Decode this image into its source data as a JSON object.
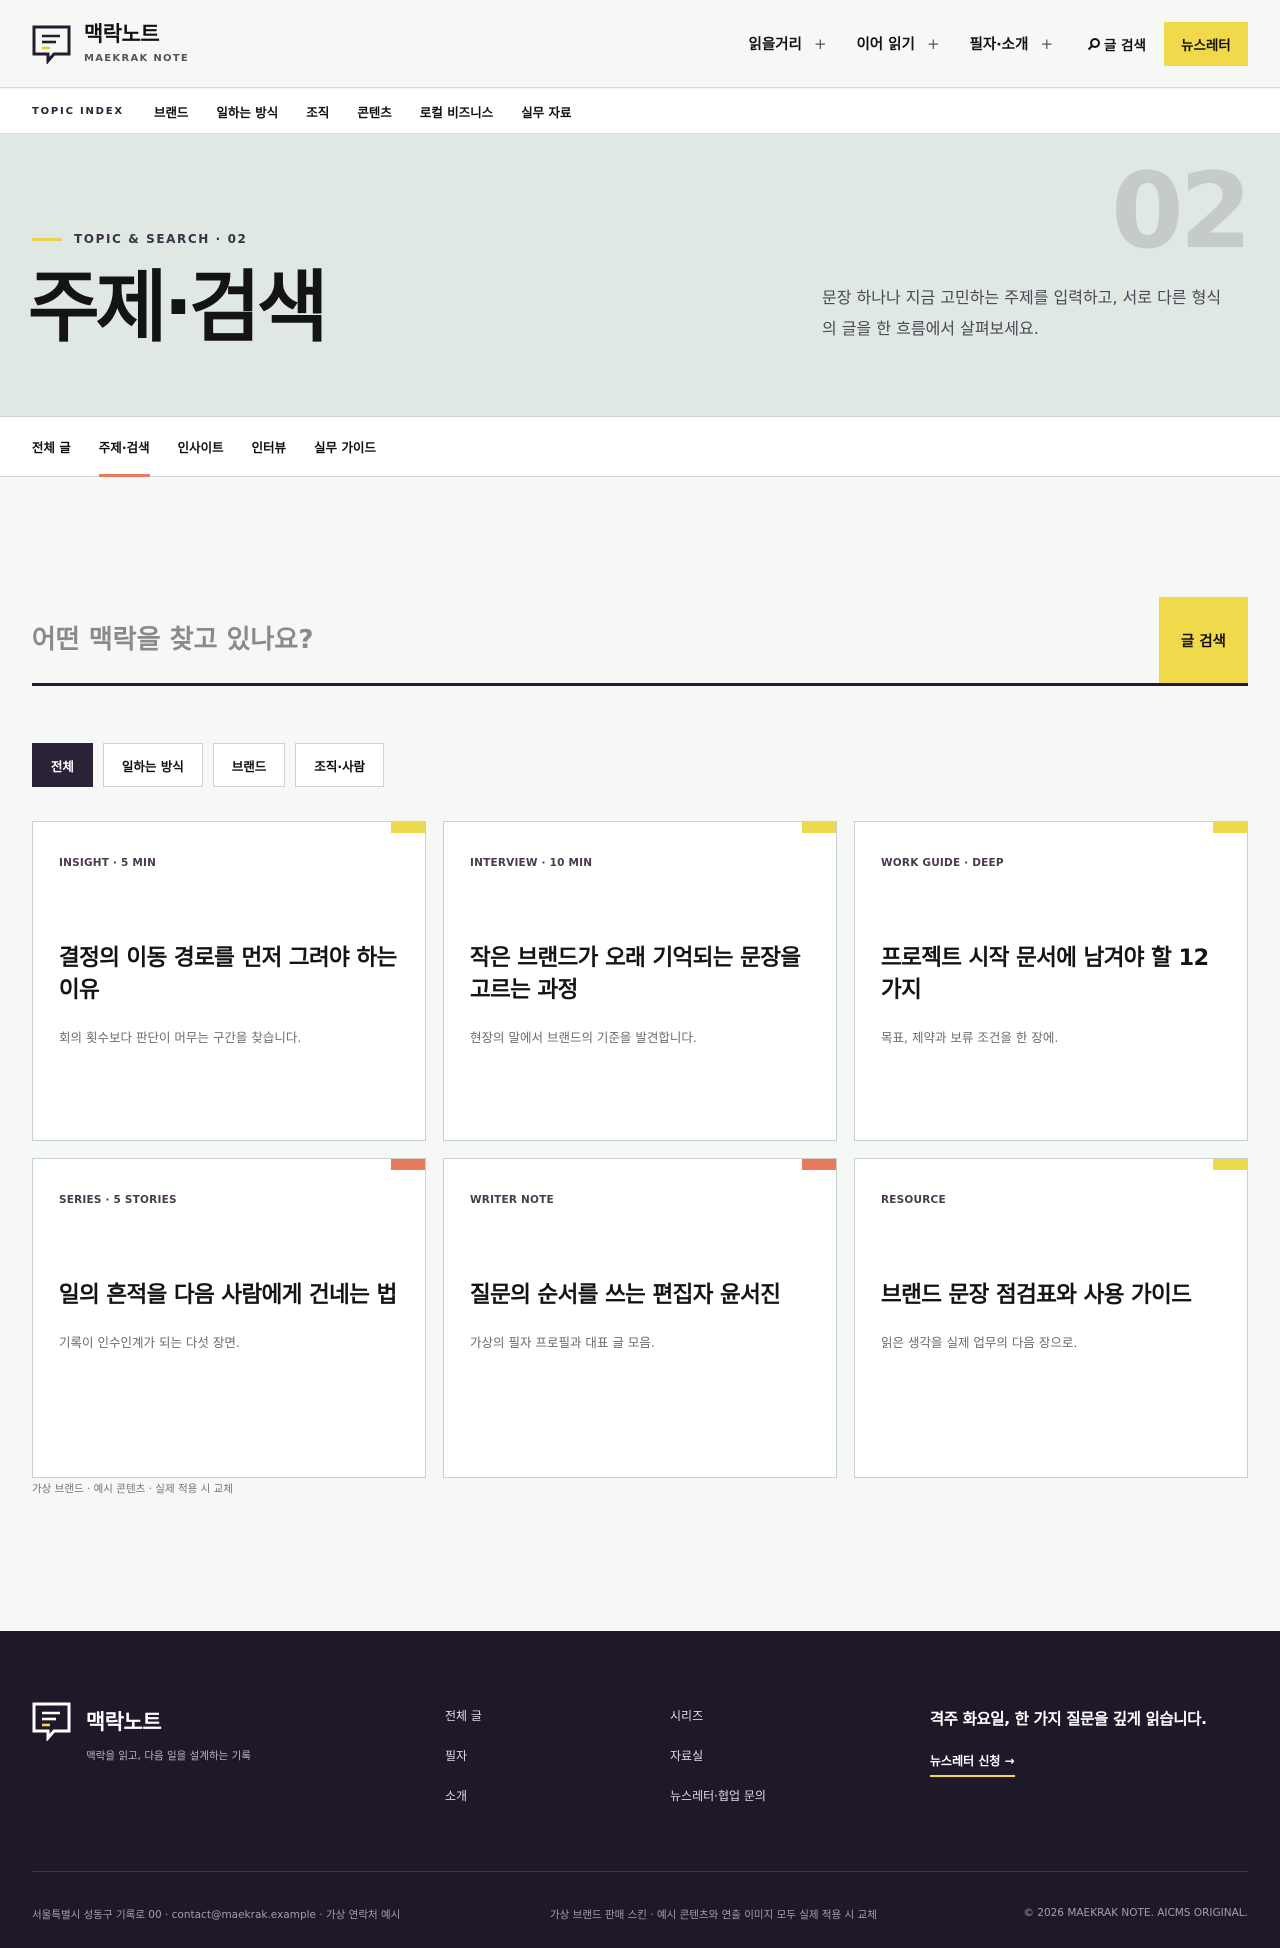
{
  "header": {
    "brand_name": "맥락노트",
    "brand_sub": "MAEKRAK NOTE",
    "nav": [
      {
        "label": "읽을거리",
        "suffix": "+"
      },
      {
        "label": "이어 읽기",
        "suffix": "+"
      },
      {
        "label": "필자·소개",
        "suffix": "+"
      }
    ],
    "search_label": "글 검색",
    "newsletter_label": "뉴스레터"
  },
  "topic_index": {
    "label": "TOPIC INDEX",
    "links": [
      "브랜드",
      "일하는 방식",
      "조직",
      "콘텐츠",
      "로컬 비즈니스",
      "실무 자료"
    ]
  },
  "hero": {
    "eyebrow": "TOPIC & SEARCH · 02",
    "title": "주제·검색",
    "number": "02",
    "description": "문장 하나나 지금 고민하는 주제를 입력하고, 서로 다른 형식의 글을 한 흐름에서 살펴보세요."
  },
  "tabs": [
    "전체 글",
    "주제·검색",
    "인사이트",
    "인터뷰",
    "실무 가이드"
  ],
  "active_tab": "주제·검색",
  "search": {
    "placeholder": "어떤 맥락을 찾고 있나요?",
    "value": "",
    "button_label": "글 검색"
  },
  "filters": [
    "전체",
    "일하는 방식",
    "브랜드",
    "조직·사람"
  ],
  "active_filter": "전체",
  "cards": [
    {
      "meta": "INSIGHT · 5 MIN",
      "title": "결정의 이동 경로를 먼저 그려야 하는 이유",
      "summary": "회의 횟수보다 판단이 머무는 구간을 찾습니다.",
      "accent": "#ecd94c"
    },
    {
      "meta": "INTERVIEW · 10 MIN",
      "title": "작은 브랜드가 오래 기억되는 문장을 고르는 과정",
      "summary": "현장의 말에서 브랜드의 기준을 발견합니다.",
      "accent": "#ecd94c"
    },
    {
      "meta": "WORK GUIDE · DEEP",
      "title": "프로젝트 시작 문서에 남겨야 할 12가지",
      "summary": "목표, 제약과 보류 조건을 한 장에.",
      "accent": "#ecd94c"
    },
    {
      "meta": "SERIES · 5 STORIES",
      "title": "일의 흔적을 다음 사람에게 건네는 법",
      "summary": "기록이 인수인계가 되는 다섯 장면.",
      "accent": "#e87a5e"
    },
    {
      "meta": "WRITER NOTE",
      "title": "질문의 순서를 쓰는 편집자 윤서진",
      "summary": "가상의 필자 프로필과 대표 글 모음.",
      "accent": "#e87a5e"
    },
    {
      "meta": "RESOURCE",
      "title": "브랜드 문장 점검표와 사용 가이드",
      "summary": "읽은 생각을 실제 업무의 다음 장으로.",
      "accent": "#ecd94c"
    }
  ],
  "caption": "가상 브랜드 · 예시 콘텐츠 · 실제 적용 시 교체",
  "footer": {
    "brand_name": "맥락노트",
    "tagline": "맥락을 읽고, 다음 일을 설계하는 기록",
    "col1": [
      "전체 글",
      "필자",
      "소개"
    ],
    "col2": [
      "시리즈",
      "자료실",
      "뉴스레터·협업 문의"
    ],
    "cta_title": "격주 화요일, 한 가지 질문을 깊게 읽습니다.",
    "cta_link": "뉴스레터 신청",
    "address": "서울특별시 성동구 기록로 00 · contact@maekrak.example · 가상 연락처 예시",
    "notice": "가상 브랜드 판매 스킨 · 예시 콘텐츠와 연출 이미지 모두 실제 적용 시 교체",
    "copyright": "© 2026 MAEKRAK NOTE. AICMS ORIGINAL."
  },
  "colors": {
    "accent_yellow": "#f0d94a",
    "accent_coral": "#e87a5e",
    "ink": "#241b30",
    "hero_bg": "#dfe8e2",
    "footer_bg": "#1f1828"
  }
}
